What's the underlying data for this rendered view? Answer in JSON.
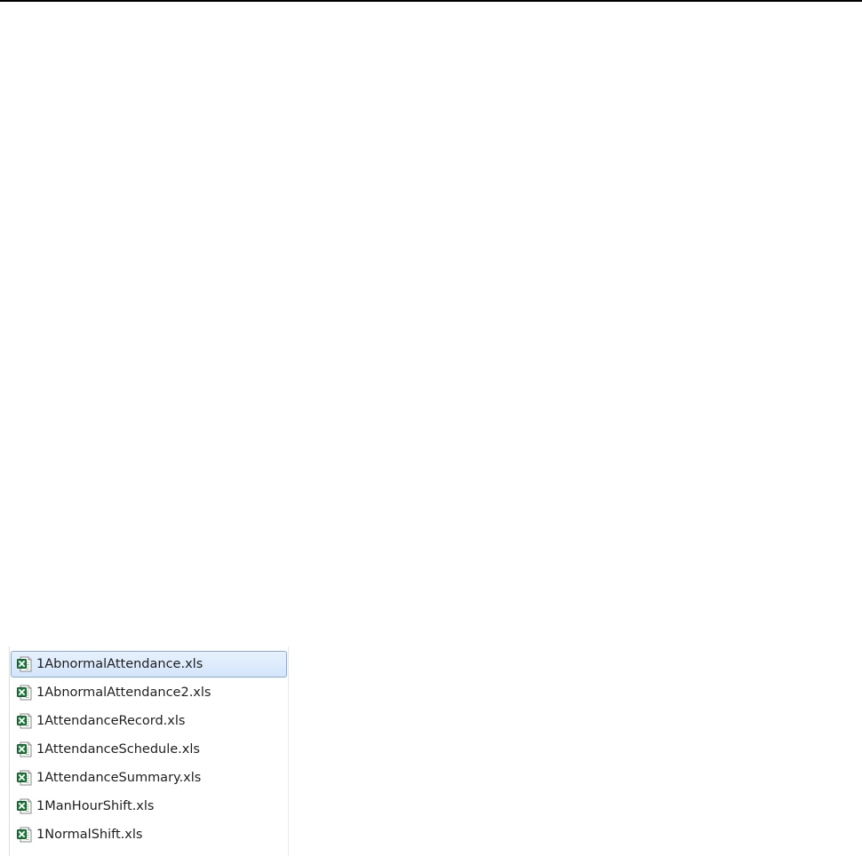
{
  "files": [
    {
      "name": "1AbnormalAttendance.xls",
      "icon": "excel-file-icon",
      "selected": true
    },
    {
      "name": "1AbnormalAttendance2.xls",
      "icon": "excel-file-icon",
      "selected": false
    },
    {
      "name": "1AttendanceRecord.xls",
      "icon": "excel-file-icon",
      "selected": false
    },
    {
      "name": "1AttendanceSchedule.xls",
      "icon": "excel-file-icon",
      "selected": false
    },
    {
      "name": "1AttendanceSummary.xls",
      "icon": "excel-file-icon",
      "selected": false
    },
    {
      "name": "1ManHourShift.xls",
      "icon": "excel-file-icon",
      "selected": false
    },
    {
      "name": "1NormalShift.xls",
      "icon": "excel-file-icon",
      "selected": false
    }
  ],
  "colors": {
    "selection_fill": "#d9e8fb",
    "selection_border": "#84acdd",
    "excel_green": "#1f7a3c",
    "top_border": "#000000"
  }
}
